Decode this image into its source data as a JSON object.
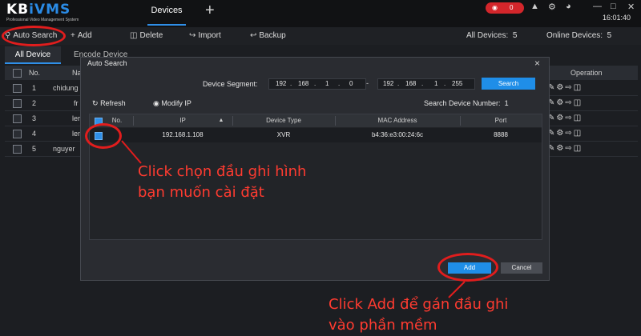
{
  "app": {
    "brand_a": "KB",
    "brand_b": "iVMS",
    "tagline": "Professional Video Management System",
    "tab_title": "Devices",
    "add_tab": "+",
    "alarm_count": "0",
    "clock": "16:01:40"
  },
  "toolbar": {
    "auto_search": "Auto Search",
    "add": "Add",
    "delete": "Delete",
    "import": "Import",
    "backup": "Backup",
    "all_devices_label": "All Devices:",
    "all_devices_value": "5",
    "online_devices_label": "Online Devices:",
    "online_devices_value": "5"
  },
  "tabs": {
    "all_device": "All Device",
    "encode_device": "Encode Device"
  },
  "main_table": {
    "col_no": "No.",
    "col_name": "Na",
    "col_operation": "Operation",
    "rows": [
      {
        "no": "1",
        "name": "chidung"
      },
      {
        "no": "2",
        "name": "fr"
      },
      {
        "no": "3",
        "name": "ler"
      },
      {
        "no": "4",
        "name": "lem"
      },
      {
        "no": "5",
        "name": "nguyer"
      }
    ]
  },
  "modal": {
    "title": "Auto Search",
    "close": "×",
    "segment_label": "Device Segment:",
    "start_ip": [
      "192",
      "168",
      "1",
      "0"
    ],
    "end_ip": [
      "192",
      "168",
      "1",
      "255"
    ],
    "ip_dot": ".",
    "segment_dash": "-",
    "search": "Search",
    "refresh": "Refresh",
    "modify_ip": "Modify IP",
    "search_device_number_label": "Search Device Number:",
    "search_device_number_value": "1",
    "columns": [
      "No.",
      "IP",
      "Device Type",
      "MAC Address",
      "Port"
    ],
    "rows": [
      {
        "ip": "192.168.1.108",
        "device_type": "XVR",
        "mac": "b4:36:e3:00:24:6c",
        "port": "8888"
      }
    ],
    "add": "Add",
    "cancel": "Cancel"
  },
  "annotations": {
    "line1": "Click chọn đầu ghi hình",
    "line2": "bạn muốn cài đặt",
    "line3": "Click Add để gán đầu ghi",
    "line4": "vào phần mềm"
  },
  "colors": {
    "accent": "#1f8ee8",
    "alarm": "#d3262b",
    "annotation": "#ff3b30",
    "ring": "#e11d1d"
  }
}
